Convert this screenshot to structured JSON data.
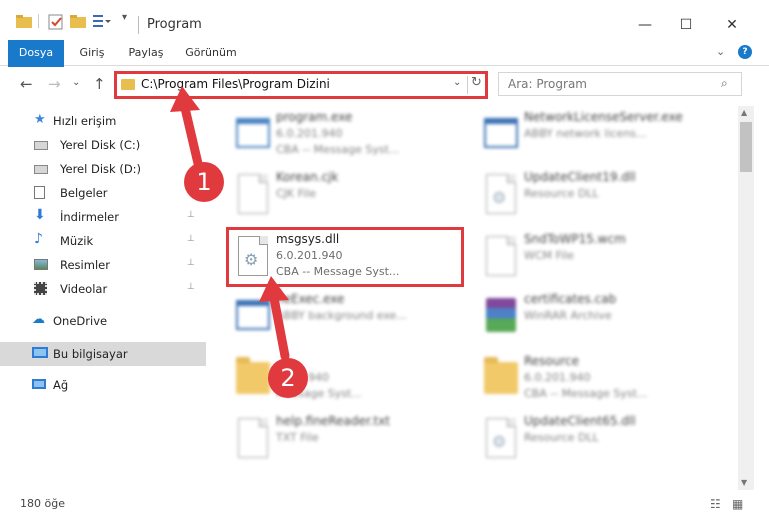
{
  "window": {
    "title": "Program",
    "minimize": "—",
    "maximize": "☐",
    "close": "✕"
  },
  "ribbon": {
    "tabs": [
      "Dosya",
      "Giriş",
      "Paylaş",
      "Görünüm"
    ],
    "expand": "⌄",
    "help": "?"
  },
  "nav": {
    "back": "←",
    "forward": "→",
    "recent": "⌄",
    "up": "↑",
    "address": "C:\\Program Files\\Program Dizini",
    "address_drop": "⌄",
    "refresh": "↻",
    "search_placeholder": "Ara: Program",
    "search_icon": "⌕"
  },
  "sidebar": {
    "items": [
      {
        "label": "Hızlı erişim",
        "icon": "star-icon",
        "color": "#3a86d8"
      },
      {
        "label": "Yerel Disk (C:)",
        "icon": "drive-icon",
        "color": "#666"
      },
      {
        "label": "Yerel Disk (D:)",
        "icon": "drive-icon",
        "color": "#666"
      },
      {
        "label": "Belgeler",
        "icon": "documents-icon",
        "color": "#666",
        "pin": "📌"
      },
      {
        "label": "İndirmeler",
        "icon": "download-icon",
        "color": "#2e7bd6",
        "pin": "📌"
      },
      {
        "label": "Müzik",
        "icon": "music-icon",
        "color": "#2e7bd6",
        "pin": "📌"
      },
      {
        "label": "Resimler",
        "icon": "pictures-icon",
        "color": "#666",
        "pin": "📌"
      },
      {
        "label": "Videolar",
        "icon": "videos-icon",
        "color": "#555",
        "pin": "📌"
      },
      {
        "label": "OneDrive",
        "icon": "onedrive-icon",
        "color": "#1979ca"
      },
      {
        "label": "Bu bilgisayar",
        "icon": "computer-icon",
        "color": "#2e7bd6"
      },
      {
        "label": "Ağ",
        "icon": "network-icon",
        "color": "#2e7bd6"
      }
    ]
  },
  "files": [
    {
      "name": "program.exe",
      "meta1": "6.0.201.940",
      "meta2": "CBA -- Message Syst...",
      "icon": "app-icon"
    },
    {
      "name": "NetworkLicenseServer.exe",
      "meta1": "ABBY network licens...",
      "meta2": "",
      "icon": "app-window-icon"
    },
    {
      "name": "Korean.cjk",
      "meta1": "CJK File",
      "meta2": "",
      "icon": "file-icon"
    },
    {
      "name": "UpdateClient19.dll",
      "meta1": "Resource DLL",
      "meta2": "",
      "icon": "dll-icon"
    },
    {
      "name": "msgsys.dll",
      "meta1": "6.0.201.940",
      "meta2": "CBA -- Message Syst...",
      "icon": "dll-icon"
    },
    {
      "name": "SndToWP15.wcm",
      "meta1": "WCM File",
      "meta2": "",
      "icon": "file-icon"
    },
    {
      "name": "neExec.exe",
      "meta1": "ABBY background exe...",
      "meta2": "",
      "icon": "app-window-icon"
    },
    {
      "name": "certificates.cab",
      "meta1": "WinRAR Archive",
      "meta2": "",
      "icon": "winrar-icon"
    },
    {
      "name": "...",
      "meta1": "940",
      "meta2": "Message Syst...",
      "icon": "folder-icon"
    },
    {
      "name": "Resource",
      "meta1": "6.0.201.940",
      "meta2": "CBA -- Message Syst...",
      "icon": "folder-icon"
    },
    {
      "name": "help.fineReader.txt",
      "meta1": "TXT File",
      "meta2": "",
      "icon": "file-icon"
    },
    {
      "name": "UpdateClient65.dll",
      "meta1": "Resource DLL",
      "meta2": "",
      "icon": "dll-icon"
    }
  ],
  "annotations": {
    "step1": "1",
    "step2": "2"
  },
  "status": {
    "count": "180 öğe"
  },
  "colors": {
    "accent": "#1979ca",
    "highlight": "#e0393e",
    "folder": "#f0c04e"
  }
}
